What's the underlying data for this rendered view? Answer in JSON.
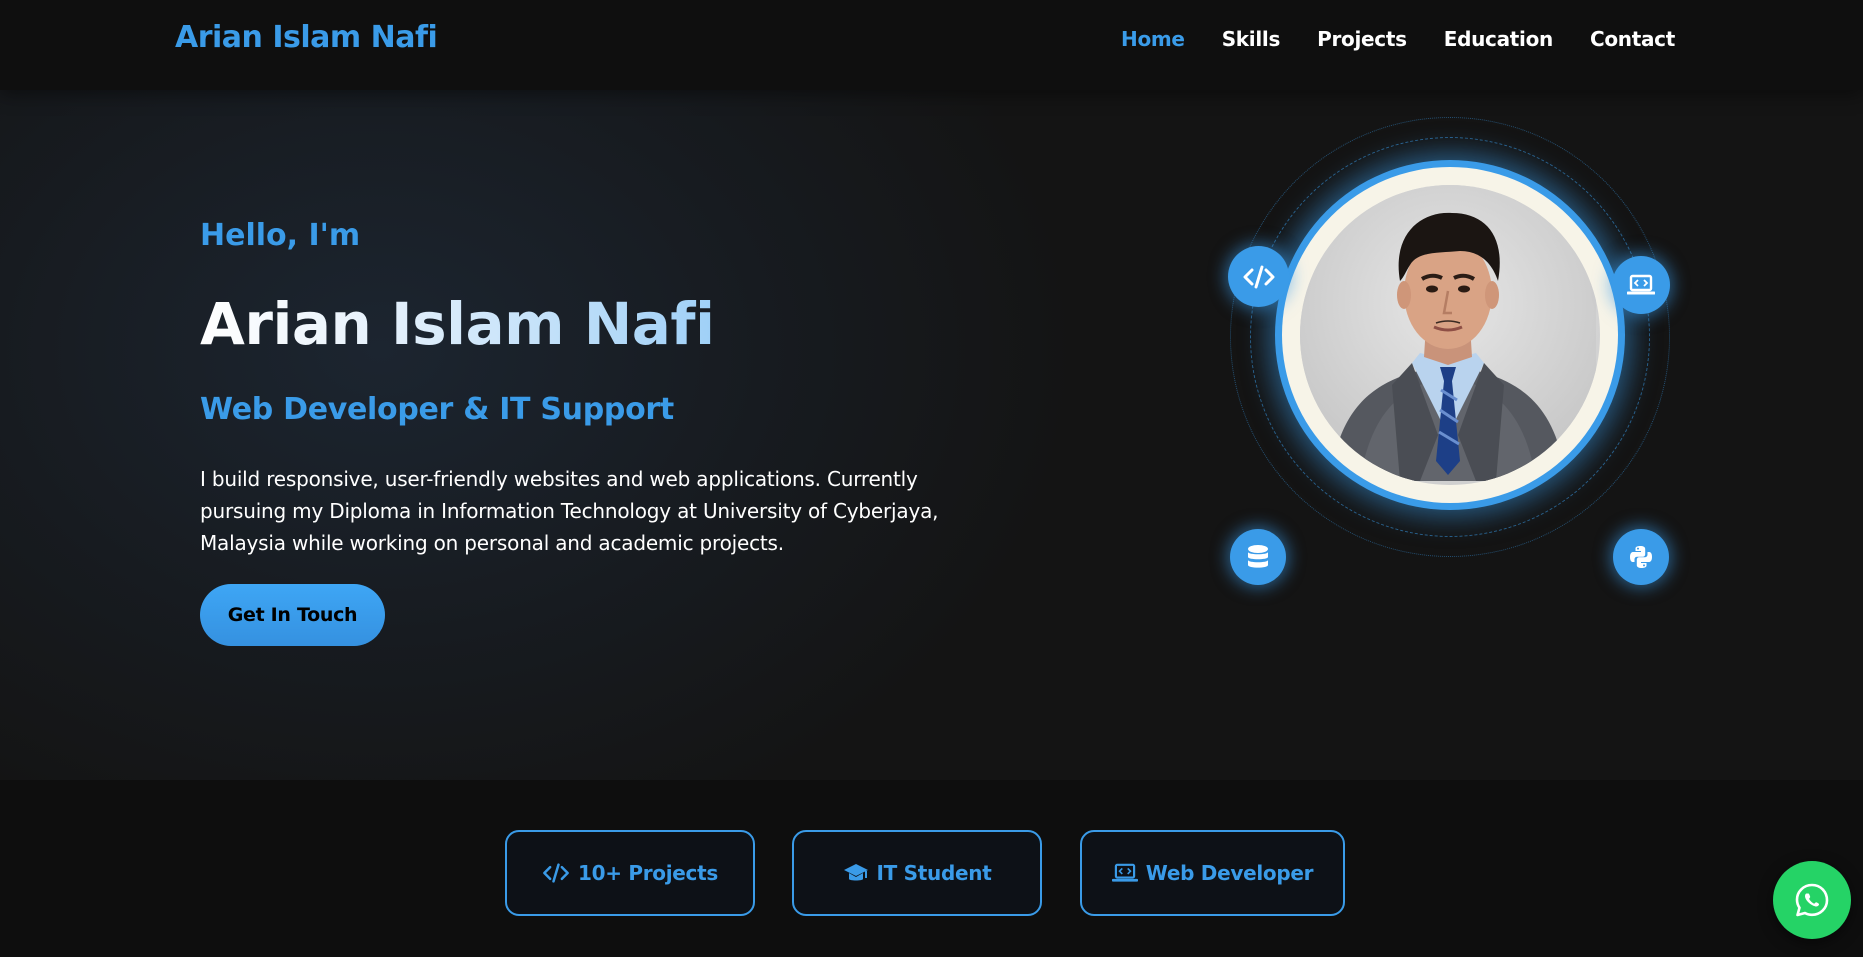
{
  "nav": {
    "brand": "Arian Islam Nafi",
    "links": [
      "Home",
      "Skills",
      "Projects",
      "Education",
      "Contact"
    ],
    "active": "Home"
  },
  "hero": {
    "greeting": "Hello, I'm",
    "name": "Arian Islam Nafi",
    "role": "Web Developer & IT Support",
    "bio": "I build responsive, user-friendly websites and web applications. Currently pursuing my Diploma in Information Technology at University of Cyberjaya, Malaysia while working on personal and academic projects.",
    "cta_label": "Get In Touch"
  },
  "profile": {
    "orbit_icons": [
      "code-icon",
      "laptop-code-icon",
      "database-icon",
      "python-icon"
    ]
  },
  "stats": [
    {
      "icon": "code-icon",
      "label": "10+ Projects"
    },
    {
      "icon": "graduation-cap-icon",
      "label": "IT Student"
    },
    {
      "icon": "laptop-code-icon",
      "label": "Web Developer"
    }
  ],
  "floating": {
    "icon": "whatsapp-icon"
  },
  "colors": {
    "accent": "#3a9be8",
    "background": "#121212",
    "whatsapp": "#25d366"
  }
}
